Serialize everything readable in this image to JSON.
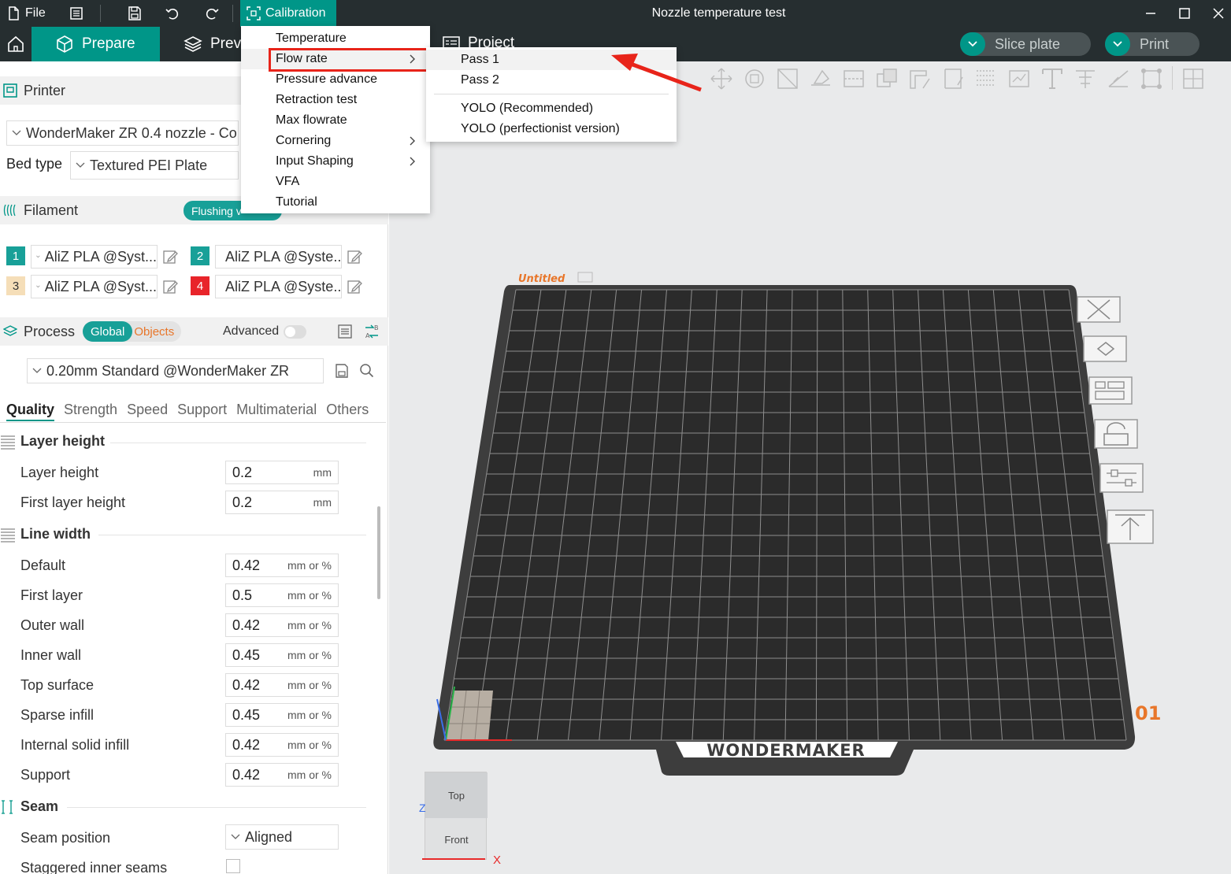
{
  "titlebar": {
    "file_label": "File",
    "calibration_label": "Calibration",
    "window_title": "Nozzle temperature test"
  },
  "nav": {
    "prepare_label": "Prepare",
    "preview_label": "Prev",
    "project_label": "Project",
    "slice_label": "Slice plate",
    "print_label": "Print"
  },
  "printer": {
    "section_label": "Printer",
    "preset": "WonderMaker ZR 0.4 nozzle - Co",
    "bed_type_label": "Bed type",
    "bed_type": "Textured PEI Plate"
  },
  "filament": {
    "section_label": "Filament",
    "flushing_label": "Flushing v",
    "slots": [
      {
        "num": "1",
        "name": "AliZ PLA @Syst...",
        "color": "#18a098"
      },
      {
        "num": "2",
        "name": "AliZ PLA @Syste...",
        "color": "#18a098"
      },
      {
        "num": "3",
        "name": "AliZ PLA @Syst...",
        "color": "#f5deb8"
      },
      {
        "num": "4",
        "name": "AliZ PLA @Syste...",
        "color": "#e8242a"
      }
    ]
  },
  "process": {
    "section_label": "Process",
    "global_label": "Global",
    "objects_label": "Objects",
    "advanced_label": "Advanced",
    "preset": "0.20mm Standard @WonderMaker ZR",
    "tabs": [
      "Quality",
      "Strength",
      "Speed",
      "Support",
      "Multimaterial",
      "Others"
    ]
  },
  "params": {
    "layer_height_group": "Layer height",
    "layer_height": {
      "label": "Layer height",
      "value": "0.2",
      "unit": "mm"
    },
    "first_layer_height": {
      "label": "First layer height",
      "value": "0.2",
      "unit": "mm"
    },
    "line_width_group": "Line width",
    "line_widths": [
      {
        "label": "Default",
        "value": "0.42",
        "unit": "mm or %"
      },
      {
        "label": "First layer",
        "value": "0.5",
        "unit": "mm or %"
      },
      {
        "label": "Outer wall",
        "value": "0.42",
        "unit": "mm or %"
      },
      {
        "label": "Inner wall",
        "value": "0.45",
        "unit": "mm or %"
      },
      {
        "label": "Top surface",
        "value": "0.42",
        "unit": "mm or %"
      },
      {
        "label": "Sparse infill",
        "value": "0.45",
        "unit": "mm or %"
      },
      {
        "label": "Internal solid infill",
        "value": "0.42",
        "unit": "mm or %"
      },
      {
        "label": "Support",
        "value": "0.42",
        "unit": "mm or %"
      }
    ],
    "seam_group": "Seam",
    "seam_position_label": "Seam position",
    "seam_position": "Aligned",
    "staggered_label": "Staggered inner seams"
  },
  "calibration_menu": {
    "items": [
      "Temperature",
      "Flow rate",
      "Pressure advance",
      "Retraction test",
      "Max flowrate",
      "Cornering",
      "Input Shaping",
      "VFA",
      "Tutorial"
    ]
  },
  "flow_submenu": {
    "items": [
      "Pass 1",
      "Pass 2",
      "YOLO (Recommended)",
      "YOLO (perfectionist version)"
    ]
  },
  "viewport": {
    "plate_name": "Untitled",
    "plate_number": "01",
    "brand": "WONDERMAKER",
    "cube_top": "Top",
    "cube_front": "Front",
    "axis_x": "X",
    "axis_z": "Z"
  },
  "colors": {
    "accent": "#009688",
    "dark_bar": "#262e30",
    "highlight_red": "#e8241a",
    "plate": "#3a3a3a"
  }
}
